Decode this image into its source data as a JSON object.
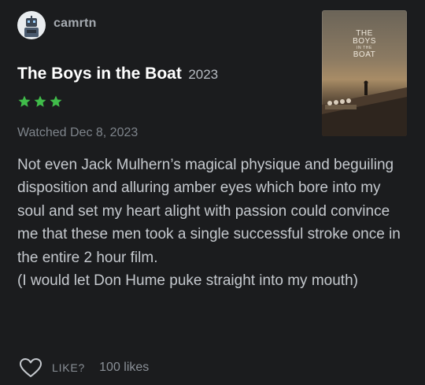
{
  "user": {
    "username": "camrtn",
    "avatar_icon": "robot-avatar-icon"
  },
  "film": {
    "title": "The Boys in the Boat",
    "year": "2023",
    "poster_title_lines": [
      "THE",
      "BOYS",
      "IN THE",
      "BOAT"
    ]
  },
  "rating": {
    "stars": 3,
    "star_color": "#40bc4a"
  },
  "watched": "Watched Dec 8, 2023",
  "review": {
    "paragraph1": "Not even Jack Mulhern’s magical physique and beguiling disposition and alluring amber eyes which bore into my soul and set my heart alight with passion could convince me that these men took a single successful stroke once in the entire 2 hour film.",
    "paragraph2": "(I would let Don Hume puke straight into my mouth)"
  },
  "footer": {
    "like_label": "LIKE?",
    "likes_count": "100 likes",
    "like_icon": "heart-outline-icon"
  }
}
